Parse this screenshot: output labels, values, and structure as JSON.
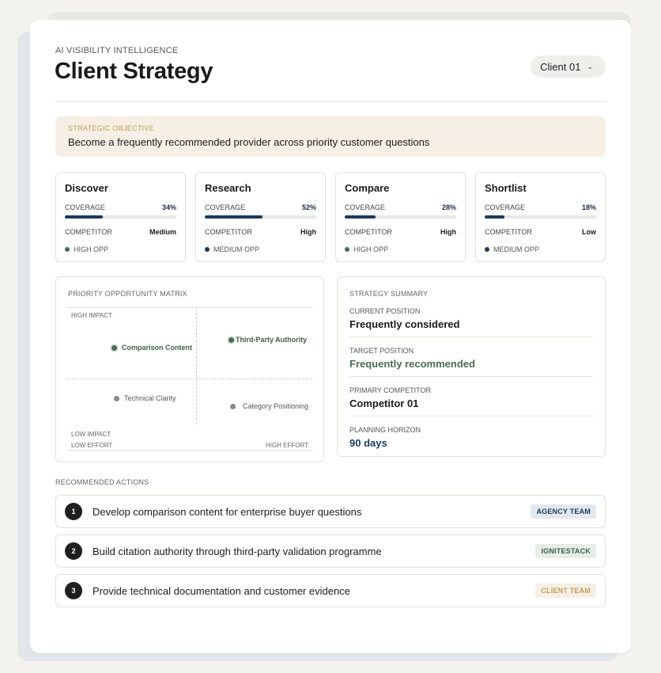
{
  "header": {
    "eyebrow": "AI VISIBILITY INTELLIGENCE",
    "title": "Client Strategy",
    "client_select": "Client 01"
  },
  "objective": {
    "label": "STRATEGIC OBJECTIVE",
    "text": "Become a frequently recommended provider across priority customer questions"
  },
  "stages": [
    {
      "name": "Discover",
      "coverage_label": "COVERAGE",
      "coverage": "34%",
      "coverage_fraction": 0.34,
      "competitor_label": "COMPETITOR",
      "competitor": "Medium",
      "opportunity": "HIGH OPP",
      "opp_color": "#4a6b55"
    },
    {
      "name": "Research",
      "coverage_label": "COVERAGE",
      "coverage": "52%",
      "coverage_fraction": 0.52,
      "competitor_label": "COMPETITOR",
      "competitor": "High",
      "opportunity": "MEDIUM OPP",
      "opp_color": "#1b3a5c"
    },
    {
      "name": "Compare",
      "coverage_label": "COVERAGE",
      "coverage": "28%",
      "coverage_fraction": 0.28,
      "competitor_label": "COMPETITOR",
      "competitor": "High",
      "opportunity": "HIGH OPP",
      "opp_color": "#4a6b55"
    },
    {
      "name": "Shortlist",
      "coverage_label": "COVERAGE",
      "coverage": "18%",
      "coverage_fraction": 0.18,
      "competitor_label": "COMPETITOR",
      "competitor": "Low",
      "opportunity": "MEDIUM OPP",
      "opp_color": "#1b3a5c"
    }
  ],
  "matrix": {
    "label": "PRIORITY OPPORTUNITY MATRIX",
    "high_impact": "HIGH IMPACT",
    "low_impact": "LOW IMPACT",
    "low_effort": "LOW EFFORT",
    "high_effort": "HIGH EFFORT",
    "points": [
      {
        "label": "Comparison Content",
        "priority": "high"
      },
      {
        "label": "Third-Party Authority",
        "priority": "high"
      },
      {
        "label": "Technical Clarity",
        "priority": "low"
      },
      {
        "label": "Category Positioning",
        "priority": "low"
      }
    ]
  },
  "summary": {
    "label": "STRATEGY SUMMARY",
    "items": [
      {
        "key": "CURRENT POSITION",
        "value": "Frequently considered"
      },
      {
        "key": "TARGET POSITION",
        "value": "Frequently recommended"
      },
      {
        "key": "PRIMARY COMPETITOR",
        "value": "Competitor 01"
      },
      {
        "key": "PLANNING HORIZON",
        "value": "90 days"
      }
    ]
  },
  "actions": {
    "label": "RECOMMENDED ACTIONS",
    "items": [
      {
        "num": "1",
        "text": "Develop comparison content for enterprise buyer questions",
        "owner": "AGENCY TEAM"
      },
      {
        "num": "2",
        "text": "Build citation authority through third-party validation programme",
        "owner": "IGNITESTACK"
      },
      {
        "num": "3",
        "text": "Provide technical documentation and customer evidence",
        "owner": "CLIENT TEAM"
      }
    ]
  },
  "colors": {
    "navy": "#1b3a5c",
    "green": "#4a6b55",
    "gold": "#c59e5a"
  }
}
